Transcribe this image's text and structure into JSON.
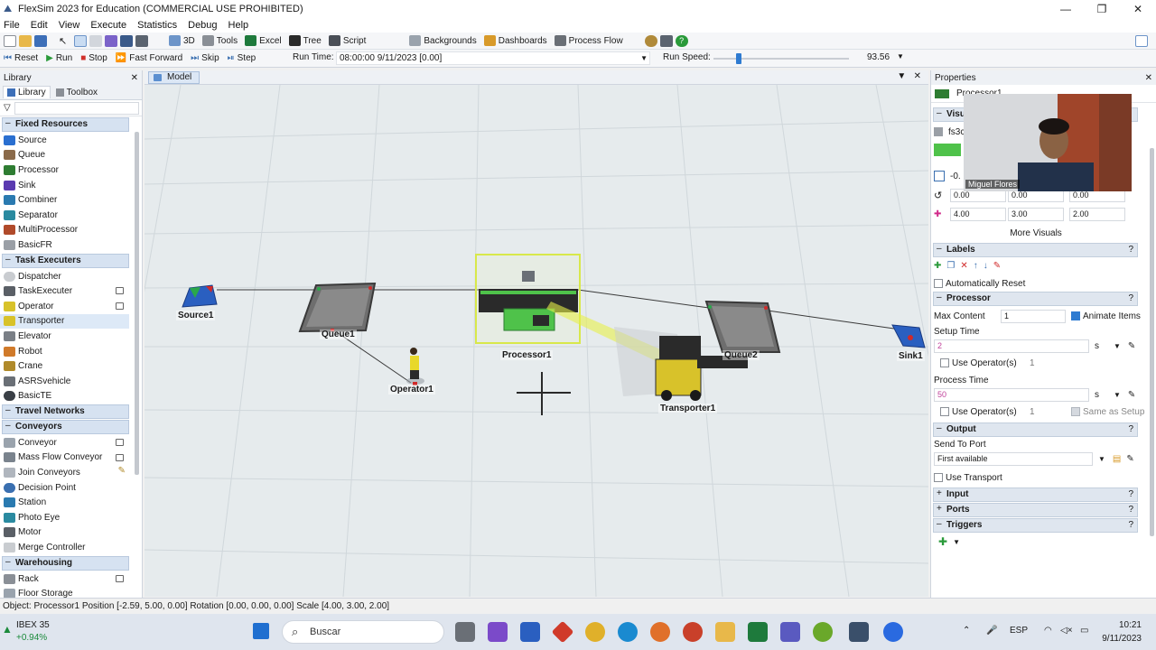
{
  "window": {
    "title": "FlexSim 2023 for Education (COMMERCIAL USE PROHIBITED)",
    "minimize": "—",
    "maximize": "❐",
    "close": "✕"
  },
  "menu": [
    "File",
    "Edit",
    "View",
    "Execute",
    "Statistics",
    "Debug",
    "Help"
  ],
  "toolbar": {
    "view_3d": "3D",
    "tools": "Tools",
    "excel": "Excel",
    "tree": "Tree",
    "script": "Script",
    "backgrounds": "Backgrounds",
    "dashboards": "Dashboards",
    "process_flow": "Process Flow"
  },
  "run_controls": {
    "reset": "Reset",
    "run": "Run",
    "stop": "Stop",
    "fast_forward": "Fast Forward",
    "skip": "Skip",
    "step": "Step",
    "run_time_label": "Run Time:",
    "run_time_value": "08:00:00  9/11/2023  [0.00]",
    "run_speed_label": "Run Speed:",
    "run_speed_value": "93.56"
  },
  "library": {
    "title": "Library",
    "tabs": [
      "Library",
      "Toolbox"
    ],
    "groups": [
      {
        "name": "Fixed Resources",
        "items": [
          "Source",
          "Queue",
          "Processor",
          "Sink",
          "Combiner",
          "Separator",
          "MultiProcessor",
          "BasicFR"
        ]
      },
      {
        "name": "Task Executers",
        "items": [
          "Dispatcher",
          "TaskExecuter",
          "Operator",
          "Transporter",
          "Elevator",
          "Robot",
          "Crane",
          "ASRSvehicle",
          "BasicTE"
        ]
      },
      {
        "name": "Travel Networks",
        "items": []
      },
      {
        "name": "Conveyors",
        "items": [
          "Conveyor",
          "Mass Flow Conveyor",
          "Join Conveyors",
          "Decision Point",
          "Station",
          "Photo Eye",
          "Motor",
          "Merge Controller"
        ]
      },
      {
        "name": "Warehousing",
        "items": [
          "Rack",
          "Floor Storage"
        ]
      }
    ]
  },
  "model": {
    "tab": "Model",
    "objects": {
      "source": "Source1",
      "queue1": "Queue1",
      "processor": "Processor1",
      "queue2": "Queue2",
      "sink": "Sink1",
      "operator": "Operator1",
      "transporter": "Transporter1"
    }
  },
  "properties": {
    "title": "Properties",
    "object_name": "Processor1",
    "visual_head": "Visu",
    "shape_value": "fs3c",
    "position_partial": "-0.",
    "rotation": [
      "0.00",
      "0.00",
      "0.00"
    ],
    "scale": [
      "4.00",
      "3.00",
      "2.00"
    ],
    "more_visuals": "More Visuals",
    "labels_head": "Labels",
    "auto_reset": "Automatically Reset",
    "processor_head": "Processor",
    "max_content_label": "Max Content",
    "max_content_value": "1",
    "animate_items": "Animate Items",
    "setup_time_label": "Setup Time",
    "setup_time_value": "2",
    "unit_s": "s",
    "use_operators": "Use Operator(s)",
    "operators_count": "1",
    "process_time_label": "Process Time",
    "process_time_value": "50",
    "same_as_setup": "Same as Setup",
    "output_head": "Output",
    "send_to_port_label": "Send To Port",
    "send_to_port_value": "First available",
    "use_transport": "Use Transport",
    "input_head": "Input",
    "ports_head": "Ports",
    "triggers_head": "Triggers"
  },
  "webcam": {
    "name": "Miguel Flores"
  },
  "status_bar": "Object: Processor1 Position [-2.59, 5.00, 0.00]  Rotation [0.00, 0.00, 0.00]  Scale [4.00, 3.00, 2.00]",
  "taskbar": {
    "stock_name": "IBEX 35",
    "stock_change": "+0.94%",
    "search_placeholder": "Buscar",
    "language": "ESP",
    "time": "10:21",
    "date": "9/11/2023"
  },
  "colors": {
    "selected_green": "#4fc24a",
    "link_line": "#3a3a3a",
    "selection_box": "#d8e84a",
    "accent_blue": "#2f7bd1"
  }
}
